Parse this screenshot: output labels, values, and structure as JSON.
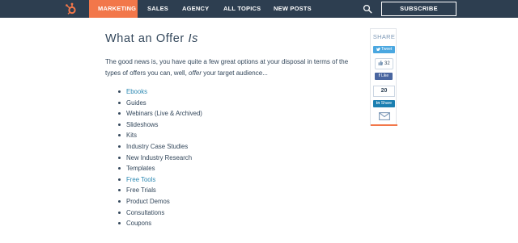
{
  "nav": {
    "logo_icon": "hubspot-sprocket-icon",
    "items": [
      {
        "label": "MARKETING",
        "active": true
      },
      {
        "label": "SALES"
      },
      {
        "label": "AGENCY"
      },
      {
        "label": "ALL TOPICS"
      },
      {
        "label": "NEW POSTS"
      }
    ],
    "search_icon": "search-icon",
    "subscribe_label": "SUBSCRIBE",
    "colors": {
      "bar": "#2d3e50",
      "active": "#f2774a"
    }
  },
  "article": {
    "heading_main": "What an Offer ",
    "heading_em": "Is",
    "intro_part1": "The good news is, you have quite a few great options at your disposal in terms of the types of offers you can, well, ",
    "intro_em": "offer",
    "intro_part2": " your target audience...",
    "offers": [
      {
        "label": "Ebooks",
        "link": true
      },
      {
        "label": "Guides"
      },
      {
        "label": "Webinars (Live & Archived)"
      },
      {
        "label": "Slideshows"
      },
      {
        "label": "Kits"
      },
      {
        "label": "Industry Case Studies"
      },
      {
        "label": "New Industry Research"
      },
      {
        "label": "Templates"
      },
      {
        "label": "Free Tools",
        "link": true
      },
      {
        "label": "Free Trials"
      },
      {
        "label": "Product Demos"
      },
      {
        "label": "Consultations"
      },
      {
        "label": "Coupons"
      }
    ],
    "link_color": "#2b88b2"
  },
  "share": {
    "label": "SHARE",
    "twitter_label": "Tweet",
    "gplus_count": "32",
    "facebook_label": "Like",
    "linkedin_count": "20",
    "linkedin_label": "Share",
    "email_icon": "envelope-icon"
  }
}
